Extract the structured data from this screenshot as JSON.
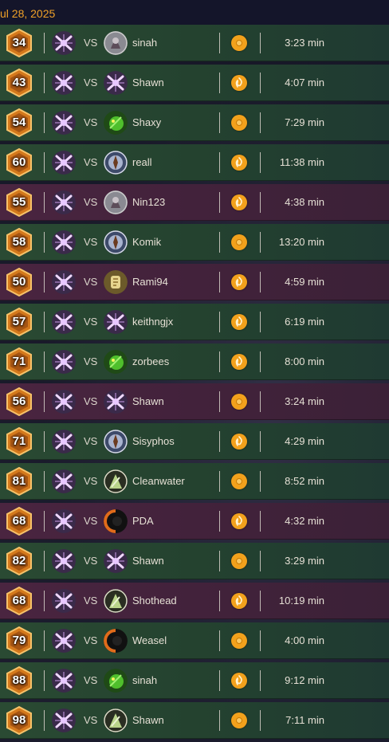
{
  "date_header": "ul 28, 2025",
  "vs_label": "VS",
  "colors": {
    "date": "#f0a128",
    "win_row": "#2a4a33",
    "loss_row": "#4a2540",
    "result_icon": "#f2a11c"
  },
  "matches": [
    {
      "level": "34",
      "opponent": "sinah",
      "opp_hero": "gray-hero-icon",
      "result": "win-medal-icon",
      "outcome": "win",
      "time": "3:23 min"
    },
    {
      "level": "43",
      "opponent": "Shawn",
      "opp_hero": "crossed-blades-hero-icon",
      "result": "flame-icon",
      "outcome": "win",
      "time": "4:07 min"
    },
    {
      "level": "54",
      "opponent": "Shaxy",
      "opp_hero": "green-goblin-hero-icon",
      "result": "win-medal-icon",
      "outcome": "win",
      "time": "7:29 min"
    },
    {
      "level": "60",
      "opponent": "reall",
      "opp_hero": "blue-knight-hero-icon",
      "result": "flame-icon",
      "outcome": "win",
      "time": "11:38 min"
    },
    {
      "level": "55",
      "opponent": "Nin123",
      "opp_hero": "gray-hero-icon",
      "result": "flame-icon",
      "outcome": "loss",
      "time": "4:38 min"
    },
    {
      "level": "58",
      "opponent": "Komik",
      "opp_hero": "blue-knight-hero-icon",
      "result": "win-medal-icon",
      "outcome": "win",
      "time": "13:20 min"
    },
    {
      "level": "50",
      "opponent": "Rami94",
      "opp_hero": "golden-scroll-hero-icon",
      "result": "flame-icon",
      "outcome": "loss",
      "time": "4:59 min"
    },
    {
      "level": "57",
      "opponent": "keithngjx",
      "opp_hero": "crossed-blades-hero-icon",
      "result": "flame-icon",
      "outcome": "win",
      "time": "6:19 min"
    },
    {
      "level": "71",
      "opponent": "zorbees",
      "opp_hero": "green-goblin-hero-icon",
      "result": "flame-icon",
      "outcome": "win",
      "time": "8:00 min"
    },
    {
      "level": "56",
      "opponent": "Shawn",
      "opp_hero": "crossed-blades-hero-icon",
      "result": "win-medal-icon",
      "outcome": "loss",
      "time": "3:24 min"
    },
    {
      "level": "71",
      "opponent": "Sisyphos",
      "opp_hero": "blue-knight-hero-icon",
      "result": "flame-icon",
      "outcome": "win",
      "time": "4:29 min"
    },
    {
      "level": "81",
      "opponent": "Cleanwater",
      "opp_hero": "skull-warrior-hero-icon",
      "result": "win-medal-icon",
      "outcome": "win",
      "time": "8:52 min"
    },
    {
      "level": "68",
      "opponent": "PDA",
      "opp_hero": "dark-orange-hero-icon",
      "result": "flame-icon",
      "outcome": "loss",
      "time": "4:32 min"
    },
    {
      "level": "82",
      "opponent": "Shawn",
      "opp_hero": "crossed-blades-hero-icon",
      "result": "win-medal-icon",
      "outcome": "win",
      "time": "3:29 min"
    },
    {
      "level": "68",
      "opponent": "Shothead",
      "opp_hero": "skull-warrior-hero-icon",
      "result": "flame-icon",
      "outcome": "loss",
      "time": "10:19 min"
    },
    {
      "level": "79",
      "opponent": "Weasel",
      "opp_hero": "dark-orange-hero-icon",
      "result": "win-medal-icon",
      "outcome": "win",
      "time": "4:00 min"
    },
    {
      "level": "88",
      "opponent": "sinah",
      "opp_hero": "green-goblin-hero-icon",
      "result": "flame-icon",
      "outcome": "win",
      "time": "9:12 min"
    },
    {
      "level": "98",
      "opponent": "Shawn",
      "opp_hero": "skull-warrior-hero-icon",
      "result": "win-medal-icon",
      "outcome": "win",
      "time": "7:11 min"
    }
  ]
}
